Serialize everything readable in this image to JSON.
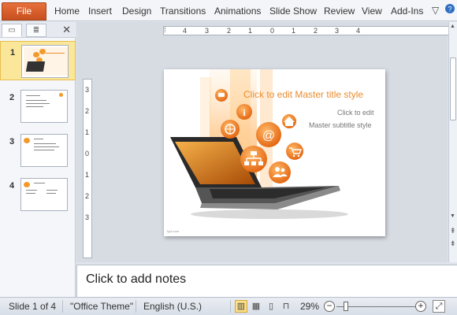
{
  "ribbon": {
    "file_label": "File",
    "tabs": [
      "Home",
      "Insert",
      "Design",
      "Transitions",
      "Animations",
      "Slide Show",
      "Review",
      "View",
      "Add-Ins"
    ]
  },
  "panel": {
    "tab_slides_icon": "slides-view-icon",
    "tab_outline_icon": "outline-view-icon",
    "close_label": "✕",
    "slides": [
      {
        "number": "1"
      },
      {
        "number": "2"
      },
      {
        "number": "3"
      },
      {
        "number": "4"
      }
    ]
  },
  "ruler": {
    "h_labels": [
      "4",
      "3",
      "2",
      "1",
      "0",
      "1",
      "2",
      "3",
      "4"
    ],
    "v_labels": [
      "3",
      "2",
      "1",
      "0",
      "1",
      "2",
      "3"
    ]
  },
  "slide": {
    "title": "Click to edit Master title style",
    "subtitle_line1": "Click to edit",
    "subtitle_line2": "Master subtitle  style",
    "footer": "fppt.com"
  },
  "notes": {
    "placeholder": "Click to add notes"
  },
  "status": {
    "slide_info": "Slide 1 of 4",
    "theme": "\"Office Theme\"",
    "language": "English (U.S.)",
    "zoom": "29%",
    "zoom_value": 29
  },
  "colors": {
    "accent": "#e66f3b",
    "title": "#e98c2e",
    "selection": "#fbe79a"
  }
}
